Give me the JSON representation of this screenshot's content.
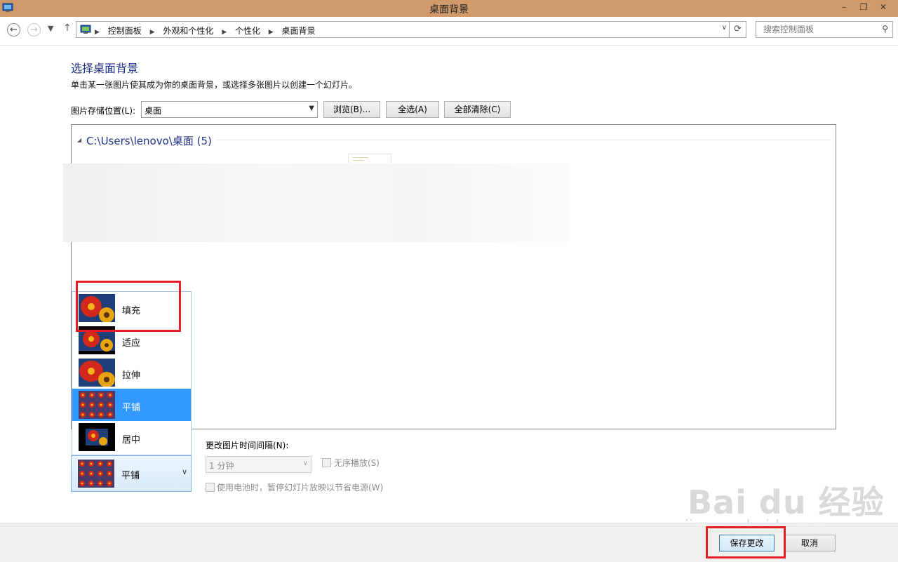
{
  "window": {
    "title": "桌面背景"
  },
  "address": {
    "crumbs": [
      "控制面板",
      "外观和个性化",
      "个性化",
      "桌面背景"
    ],
    "search_placeholder": "搜索控制面板"
  },
  "page": {
    "title": "选择桌面背景",
    "subtitle": "单击某一张图片使其成为你的桌面背景，或选择多张图片以创建一个幻灯片。"
  },
  "location": {
    "label": "图片存储位置(L):",
    "value": "桌面",
    "browse": "浏览(B)...",
    "select_all": "全选(A)",
    "clear_all": "全部清除(C)"
  },
  "gallery": {
    "group_title": "C:\\Users\\lenovo\\桌面 (5)"
  },
  "position_menu": {
    "items": [
      "填充",
      "适应",
      "拉伸",
      "平铺",
      "居中"
    ],
    "selected": "平铺"
  },
  "interval": {
    "label": "更改图片时间间隔(N):",
    "value": "1 分钟",
    "shuffle": "无序播放(S)",
    "battery": "使用电池时，暂停幻灯片放映以节省电源(W)"
  },
  "footer": {
    "save": "保存更改",
    "cancel": "取消"
  },
  "watermark": {
    "logo": "Bai du 经验",
    "url": "jingyan.baidu.com"
  },
  "colors": {
    "accent": "#3399ff",
    "title_bar": "#d09a6a",
    "highlight_box": "#e31e24"
  }
}
